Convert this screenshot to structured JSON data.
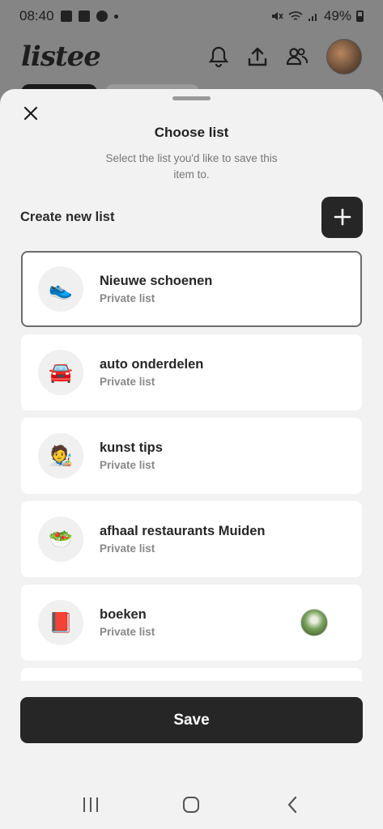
{
  "status": {
    "time": "08:40",
    "battery": "49%"
  },
  "app": {
    "logo": "listee"
  },
  "sheet": {
    "title": "Choose list",
    "subtitle": "Select the list you'd like to save this item to.",
    "create_label": "Create new list",
    "save_label": "Save",
    "lists": [
      {
        "name": "Nieuwe schoenen",
        "privacy": "Private list",
        "emoji": "👟",
        "selected": true
      },
      {
        "name": "auto onderdelen",
        "privacy": "Private list",
        "emoji": "🚘",
        "selected": false
      },
      {
        "name": "kunst tips",
        "privacy": "Private list",
        "emoji": "🧑‍🎨",
        "selected": false
      },
      {
        "name": "afhaal restaurants Muiden",
        "privacy": "Private list",
        "emoji": "🥗",
        "selected": false
      },
      {
        "name": "boeken",
        "privacy": "Private list",
        "emoji": "📕",
        "selected": false,
        "shared": true
      }
    ]
  },
  "colors": {
    "dark_button": "#262626",
    "sheet_bg": "#f2f2f2",
    "selected_border": "#6c6c6c"
  },
  "icons": {
    "close": "close-icon",
    "add": "plus-icon",
    "bell": "bell-icon",
    "share": "share-icon",
    "friends": "friends-icon"
  }
}
